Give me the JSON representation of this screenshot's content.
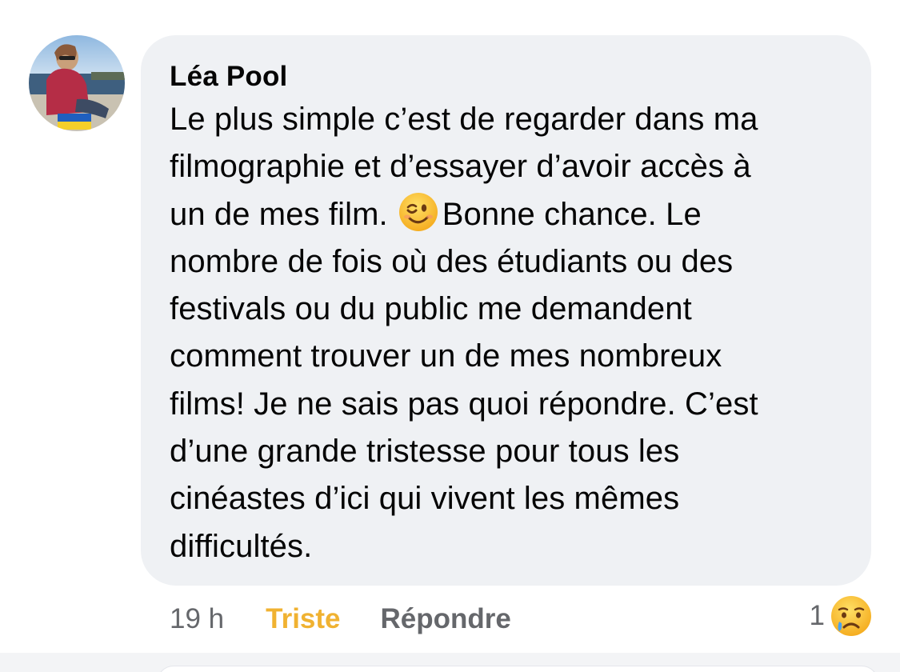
{
  "comment": {
    "author": "Léa Pool",
    "lines": [
      "Le plus simple c’est de regarder dans ma",
      "filmographie et d’essayer d’avoir accès à",
      "un de mes film.",
      "Bonne chance. Le",
      "nombre de fois où des étudiants ou des",
      "festivals ou du public me demandent",
      "comment trouver un de mes nombreux",
      "films! Je ne sais pas quoi répondre. C’est",
      "d’une grande tristesse pour tous les",
      "cinéastes d’ici qui vivent les mêmes",
      "difficultés."
    ],
    "inline_emoji": "winking-face-emoji"
  },
  "actions": {
    "timestamp": "19 h",
    "reaction_label": "Triste",
    "reply_label": "Répondre"
  },
  "reactions": {
    "count": "1",
    "icon": "sad-crying-face-emoji"
  },
  "colors": {
    "bubble": "#eff1f4",
    "reaction_active": "#f0b231",
    "muted_text": "#65676b",
    "primary_text": "#050505"
  }
}
